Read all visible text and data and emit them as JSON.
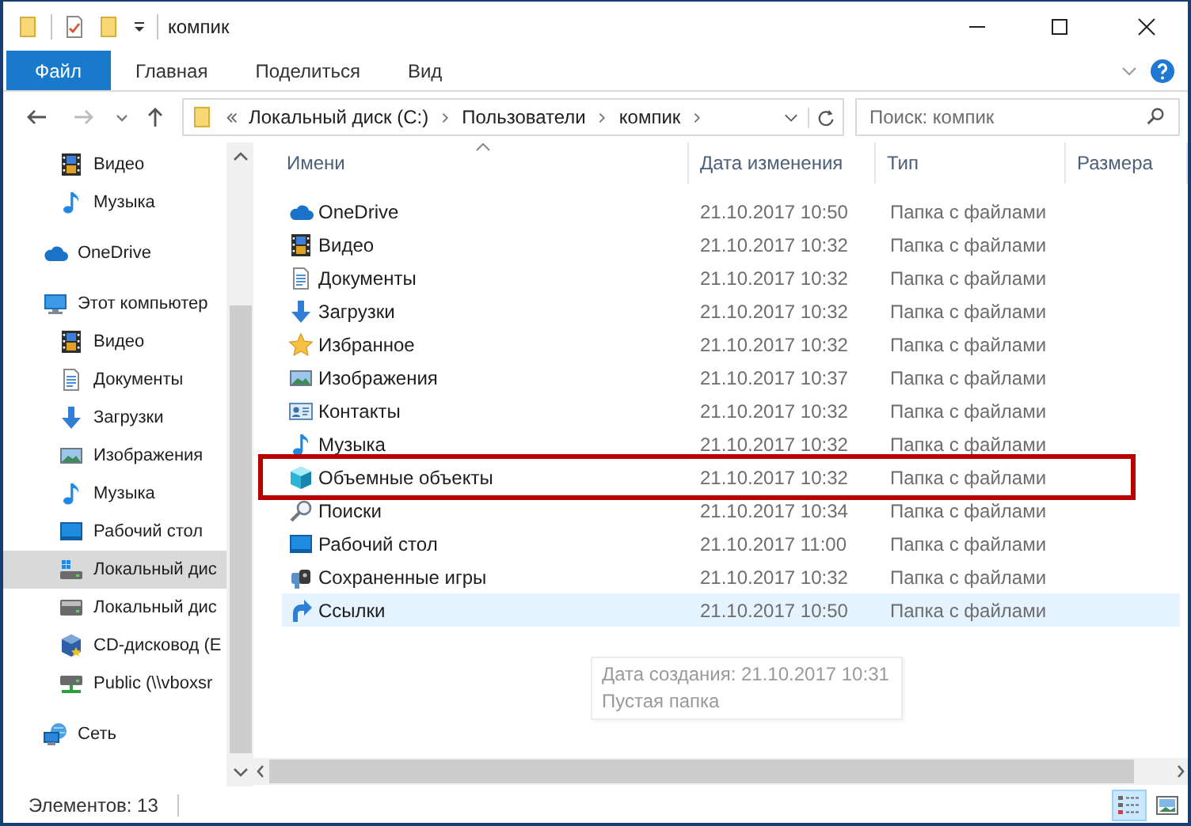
{
  "window": {
    "title": "компик"
  },
  "ribbon": {
    "tabs": [
      {
        "label": "Файл",
        "selected": true
      },
      {
        "label": "Главная",
        "selected": false
      },
      {
        "label": "Поделиться",
        "selected": false
      },
      {
        "label": "Вид",
        "selected": false
      }
    ]
  },
  "address_bar": {
    "crumbs": [
      "Локальный диск (C:)",
      "Пользователи",
      "компик"
    ]
  },
  "search": {
    "placeholder": "Поиск: компик"
  },
  "sidebar": {
    "items": [
      {
        "children": [
          {
            "label": "Видео",
            "kind": "video",
            "selected": false
          },
          {
            "label": "Музыка",
            "kind": "music",
            "selected": false
          }
        ]
      },
      {
        "label": "OneDrive",
        "kind": "onedrive",
        "selected": false
      },
      {
        "label": "Этот компьютер",
        "kind": "pc",
        "selected": false,
        "children": [
          {
            "label": "Видео",
            "kind": "video",
            "selected": false
          },
          {
            "label": "Документы",
            "kind": "docs",
            "selected": false
          },
          {
            "label": "Загрузки",
            "kind": "downloads",
            "selected": false
          },
          {
            "label": "Изображения",
            "kind": "images",
            "selected": false
          },
          {
            "label": "Музыка",
            "kind": "music",
            "selected": false
          },
          {
            "label": "Рабочий стол",
            "kind": "desktop",
            "selected": false
          },
          {
            "label": "Локальный дис",
            "kind": "system_disk",
            "selected": true
          },
          {
            "label": "Локальный дис",
            "kind": "disk",
            "selected": false
          },
          {
            "label": "CD-дисковод (E",
            "kind": "cd",
            "selected": false
          },
          {
            "label": "Public (\\\\vboxsr",
            "kind": "netdrive",
            "selected": false
          }
        ]
      },
      {
        "label": "Сеть",
        "kind": "network",
        "selected": false
      }
    ]
  },
  "file_list": {
    "columns": [
      {
        "label": "Имени",
        "sorted": true
      },
      {
        "label": "Дата изменения",
        "sorted": false
      },
      {
        "label": "Тип",
        "sorted": false
      },
      {
        "label": "Размера",
        "sorted": false
      }
    ],
    "rows": [
      {
        "name": "OneDrive",
        "modified": "21.10.2017 10:50",
        "type": "Папка с файлами",
        "kind": "onedrive",
        "hovered": false,
        "marked": false
      },
      {
        "name": "Видео",
        "modified": "21.10.2017 10:32",
        "type": "Папка с файлами",
        "kind": "video",
        "hovered": false,
        "marked": false
      },
      {
        "name": "Документы",
        "modified": "21.10.2017 10:32",
        "type": "Папка с файлами",
        "kind": "docs",
        "hovered": false,
        "marked": false
      },
      {
        "name": "Загрузки",
        "modified": "21.10.2017 10:32",
        "type": "Папка с файлами",
        "kind": "downloads",
        "hovered": false,
        "marked": false
      },
      {
        "name": "Избранное",
        "modified": "21.10.2017 10:32",
        "type": "Папка с файлами",
        "kind": "favorites",
        "hovered": false,
        "marked": false
      },
      {
        "name": "Изображения",
        "modified": "21.10.2017 10:37",
        "type": "Папка с файлами",
        "kind": "images",
        "hovered": false,
        "marked": false
      },
      {
        "name": "Контакты",
        "modified": "21.10.2017 10:32",
        "type": "Папка с файлами",
        "kind": "contacts",
        "hovered": false,
        "marked": false
      },
      {
        "name": "Музыка",
        "modified": "21.10.2017 10:32",
        "type": "Папка с файлами",
        "kind": "music",
        "hovered": false,
        "marked": false
      },
      {
        "name": "Объемные объекты",
        "modified": "21.10.2017 10:32",
        "type": "Папка с файлами",
        "kind": "objects3d",
        "hovered": false,
        "marked": true
      },
      {
        "name": "Поиски",
        "modified": "21.10.2017 10:34",
        "type": "Папка с файлами",
        "kind": "searches",
        "hovered": false,
        "marked": false
      },
      {
        "name": "Рабочий стол",
        "modified": "21.10.2017 11:00",
        "type": "Папка с файлами",
        "kind": "desktop",
        "hovered": false,
        "marked": false
      },
      {
        "name": "Сохраненные игры",
        "modified": "21.10.2017 10:32",
        "type": "Папка с файлами",
        "kind": "games",
        "hovered": false,
        "marked": false
      },
      {
        "name": "Ссылки",
        "modified": "21.10.2017 10:50",
        "type": "Папка с файлами",
        "kind": "links",
        "hovered": true,
        "marked": false
      }
    ]
  },
  "tooltip": {
    "lines": [
      "Дата создания: 21.10.2017 10:31",
      "Пустая папка"
    ]
  },
  "status_bar": {
    "item_count": "Элементов: 13"
  },
  "view_buttons": [
    {
      "kind": "details",
      "selected": true
    },
    {
      "kind": "large_icons",
      "selected": false
    }
  ]
}
